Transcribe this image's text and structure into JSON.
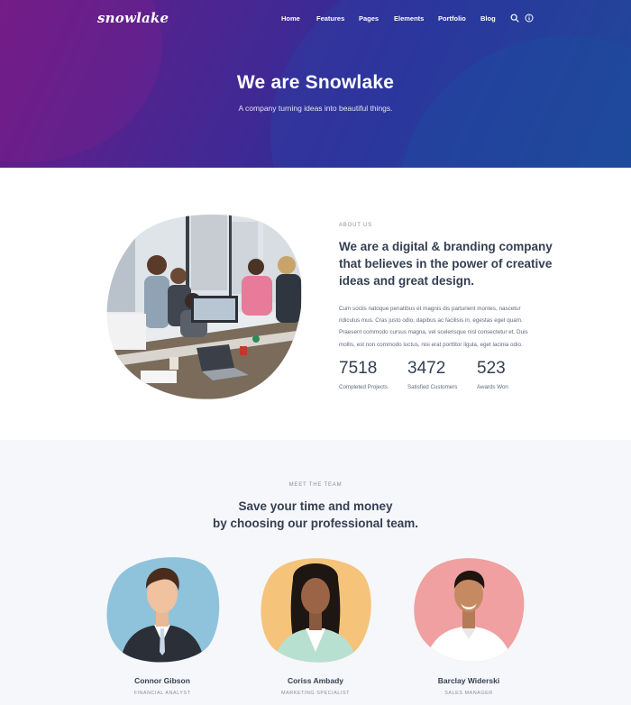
{
  "header": {
    "logo": "snowlake",
    "nav": [
      "Home",
      "Features",
      "Pages",
      "Elements",
      "Portfolio",
      "Blog"
    ],
    "icons": [
      "search-icon",
      "info-icon"
    ]
  },
  "hero": {
    "title": "We are Snowlake",
    "subtitle": "A company turning ideas into beautiful things."
  },
  "about": {
    "label": "ABOUT US",
    "heading": "We are a digital & branding company that believes in the power of creative ideas and great design.",
    "body": "Cum sociis natoque penatibus et magnis dis parturient montes, nascetur ridiculus mus. Cras justo odio, dapibus ac facilisis in, egestas eget quam. Praesent commodo cursus magna, vel scelerisque nisl consectetur et. Duis mollis, est non commodo luctus, nisi erat porttitor ligula, eget lacinia odio.",
    "stats": [
      {
        "value": "7518",
        "label": "Completed Projects"
      },
      {
        "value": "3472",
        "label": "Satisfied Customers"
      },
      {
        "value": "523",
        "label": "Awards Won"
      }
    ]
  },
  "team": {
    "label": "MEET THE TEAM",
    "heading_line1": "Save your time and money",
    "heading_line2": "by choosing our professional team.",
    "members": [
      {
        "name": "Connor Gibson",
        "role": "FINANCIAL ANALYST",
        "bg": "#8fc3dc"
      },
      {
        "name": "Coriss Ambady",
        "role": "MARKETING SPECIALIST",
        "bg": "#f5c37a"
      },
      {
        "name": "Barclay Widerski",
        "role": "SALES MANAGER",
        "bg": "#f0a0a0"
      }
    ]
  },
  "colors": {
    "hero_start": "#6d1a86",
    "hero_end": "#1d4a92",
    "text_dark": "#343f52",
    "text_muted": "#60697b",
    "team_bg": "#f6f7fa"
  }
}
